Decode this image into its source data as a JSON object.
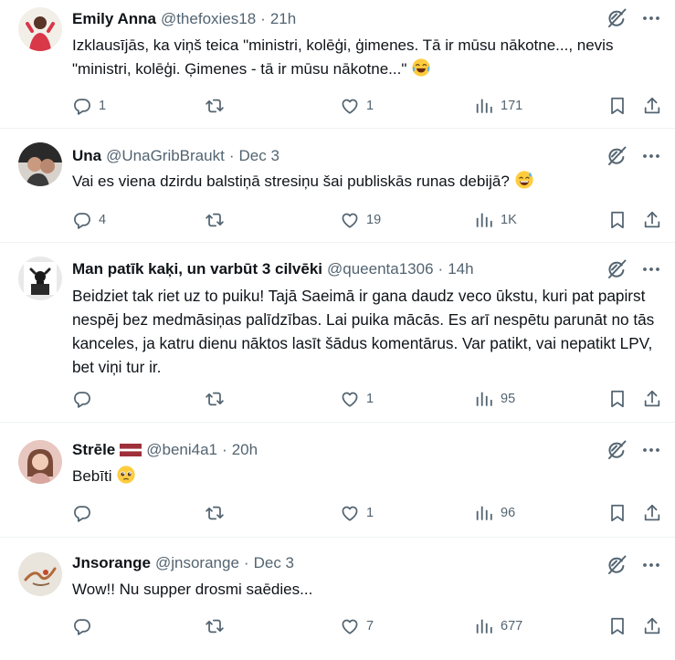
{
  "tweets": [
    {
      "name": "Emily Anna",
      "handle": "@thefoxies18",
      "time": "21h",
      "text": "Izklausījās, ka viņš teica \"ministri, kolēģi, ģimenes. Tā ir mūsu nākotne..., nevis \"ministri, kolēģi. Ģimenes - tā ir mūsu nākotne...\"",
      "emoji": "joy-emoji",
      "replies": "1",
      "retweets": "",
      "likes": "1",
      "views": "171"
    },
    {
      "name": "Una",
      "handle": "@UnaGribBraukt",
      "time": "Dec 3",
      "text": "Vai es viena dzirdu balstiņā stresiņu šai publiskās runas debijā?",
      "emoji": "sweat-smile-emoji",
      "replies": "4",
      "retweets": "",
      "likes": "19",
      "views": "1K"
    },
    {
      "name": "Man patīk kaķi, un varbūt 3 cilvēki",
      "handle": "@queenta1306",
      "time": "14h",
      "text": "Beidziet tak riet uz to puiku! Tajā Saeimā ir gana daudz veco ūkstu, kuri pat papirst nespēj bez medmāsiņas palīdzības. Lai puika mācās. Es arī nespētu parunāt no tās kanceles, ja katru dienu nāktos lasīt šādus komentārus. Var patikt, vai nepatikt LPV, bet viņi tur ir.",
      "emoji": "",
      "replies": "",
      "retweets": "",
      "likes": "1",
      "views": "95"
    },
    {
      "name": "Strēle",
      "handle": "@beni4a1",
      "time": "20h",
      "text": "Bebīti",
      "emoji": "pleading-emoji",
      "replies": "",
      "retweets": "",
      "likes": "1",
      "views": "96"
    },
    {
      "name": "Jnsorange",
      "handle": "@jnsorange",
      "time": "Dec 3",
      "text": "Wow!! Nu supper drosmi saēdies...",
      "emoji": "",
      "replies": "",
      "retweets": "",
      "likes": "7",
      "views": "677"
    }
  ],
  "separator": "·",
  "colors": {
    "text": "#0f1419",
    "secondary": "#536471",
    "border": "#eff3f4",
    "flag_red": "#9e3039"
  }
}
